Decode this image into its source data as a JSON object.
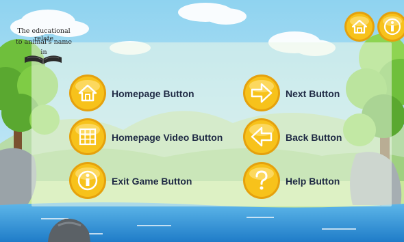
{
  "logo": {
    "line1": "The educational relate",
    "line2": "to animal's name",
    "line3": "in",
    "book_icon": "open-book-icon"
  },
  "top_buttons": {
    "home_icon": "home-icon",
    "info_icon": "info-icon"
  },
  "buttons": [
    {
      "label": "Homepage Button",
      "icon": "home-icon"
    },
    {
      "label": "Next Button",
      "icon": "arrow-right-icon"
    },
    {
      "label": "Homepage Video Button",
      "icon": "grid-icon"
    },
    {
      "label": "Back Button",
      "icon": "arrow-left-icon"
    },
    {
      "label": "Exit Game Button",
      "icon": "info-icon"
    },
    {
      "label": "Help Button",
      "icon": "question-icon"
    }
  ],
  "colors": {
    "button_gold": "#f7c21b",
    "button_border": "#e09a0c",
    "sky": "#8fd3f0",
    "water": "#2b8fd6",
    "label_text": "#1f2a44"
  }
}
